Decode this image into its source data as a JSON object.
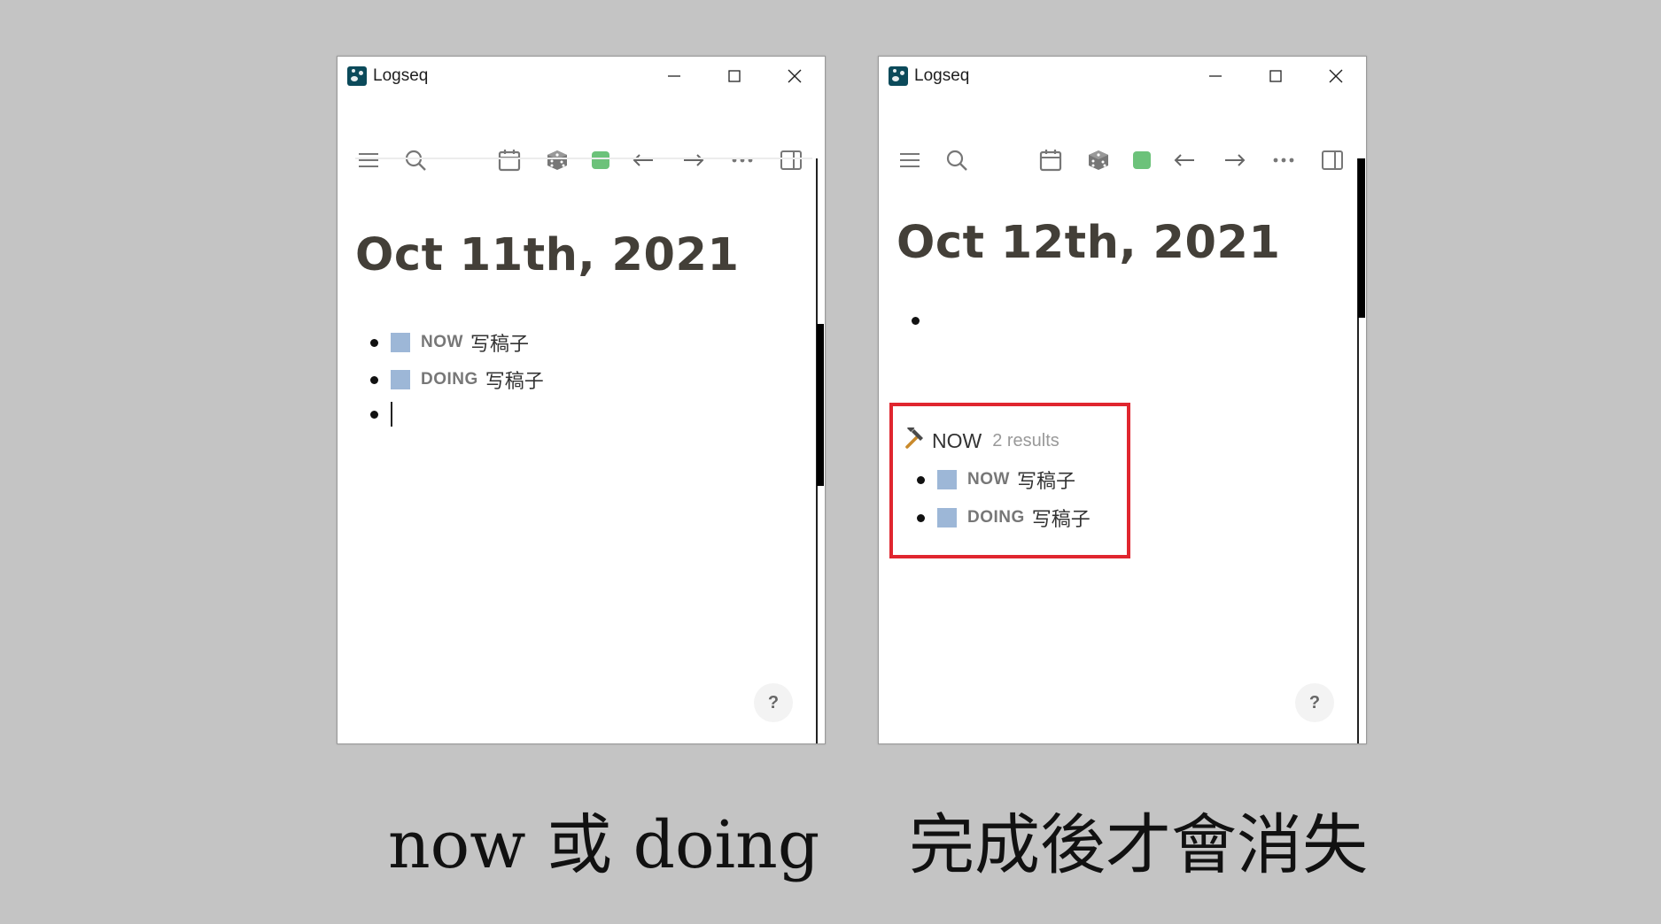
{
  "app": {
    "title": "Logseq"
  },
  "window_controls": {
    "minimize": "minimize-icon",
    "maximize": "maximize-icon",
    "close": "close-icon"
  },
  "toolbar_icons": [
    "menu-icon",
    "search-icon",
    "calendar-icon",
    "dice-icon",
    "green-square-icon",
    "back-arrow-icon",
    "forward-arrow-icon",
    "more-icon",
    "sidebar-toggle-icon"
  ],
  "colors": {
    "accent_green": "#6cc27a",
    "checkbox": "#9db7d7",
    "query_border": "#e0262f",
    "background": "#c4c4c4"
  },
  "left": {
    "page_title": "Oct 11th, 2021",
    "blocks": [
      {
        "marker": "NOW",
        "text": "写稿子"
      },
      {
        "marker": "DOING",
        "text": "写稿子"
      }
    ],
    "help": "?"
  },
  "right": {
    "page_title": "Oct 12th, 2021",
    "query": {
      "icon": "hammer-icon",
      "title": "NOW",
      "count": "2 results",
      "results": [
        {
          "marker": "NOW",
          "text": "写稿子"
        },
        {
          "marker": "DOING",
          "text": "写稿子"
        }
      ]
    },
    "help": "?"
  },
  "captions": {
    "left": "now 或 doing",
    "right": "完成後才會消失"
  }
}
